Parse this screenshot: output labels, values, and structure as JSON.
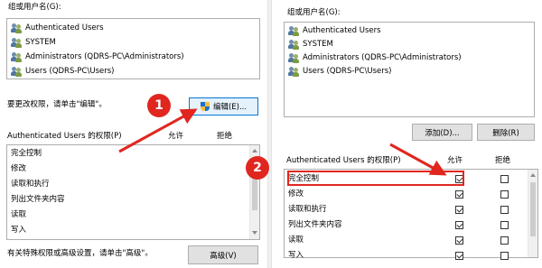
{
  "left": {
    "group_label": "组或用户名(G):",
    "users": [
      "Authenticated Users",
      "SYSTEM",
      "Administrators (QDRS-PC\\Administrators)",
      "Users (QDRS-PC\\Users)"
    ],
    "change_hint": "要更改权限，请单击\"编辑\"。",
    "edit_button": "编辑(E)...",
    "perm_header": "Authenticated Users 的权限(P)",
    "allow_col": "允许",
    "deny_col": "拒绝",
    "permissions": [
      "完全控制",
      "修改",
      "读取和执行",
      "列出文件夹内容",
      "读取",
      "写入"
    ],
    "special_hint": "有关特殊权限或高级设置，请单击\"高级\"。",
    "advanced_button": "高级(V)"
  },
  "right": {
    "group_label": "组或用户名(G):",
    "users": [
      "Authenticated Users",
      "SYSTEM",
      "Administrators (QDRS-PC\\Administrators)",
      "Users (QDRS-PC\\Users)"
    ],
    "add_button": "添加(D)...",
    "remove_button": "删除(R)",
    "perm_header": "Authenticated Users 的权限(P)",
    "allow_col": "允许",
    "deny_col": "拒绝",
    "permissions": [
      {
        "name": "完全控制",
        "allow": true,
        "deny": false
      },
      {
        "name": "修改",
        "allow": true,
        "deny": false
      },
      {
        "name": "读取和执行",
        "allow": true,
        "deny": false
      },
      {
        "name": "列出文件夹内容",
        "allow": true,
        "deny": false
      },
      {
        "name": "读取",
        "allow": true,
        "deny": false
      },
      {
        "name": "写入",
        "allow": true,
        "deny": false
      }
    ]
  },
  "annotations": {
    "step1": "1",
    "step2": "2",
    "accent_color": "#e0261f"
  }
}
